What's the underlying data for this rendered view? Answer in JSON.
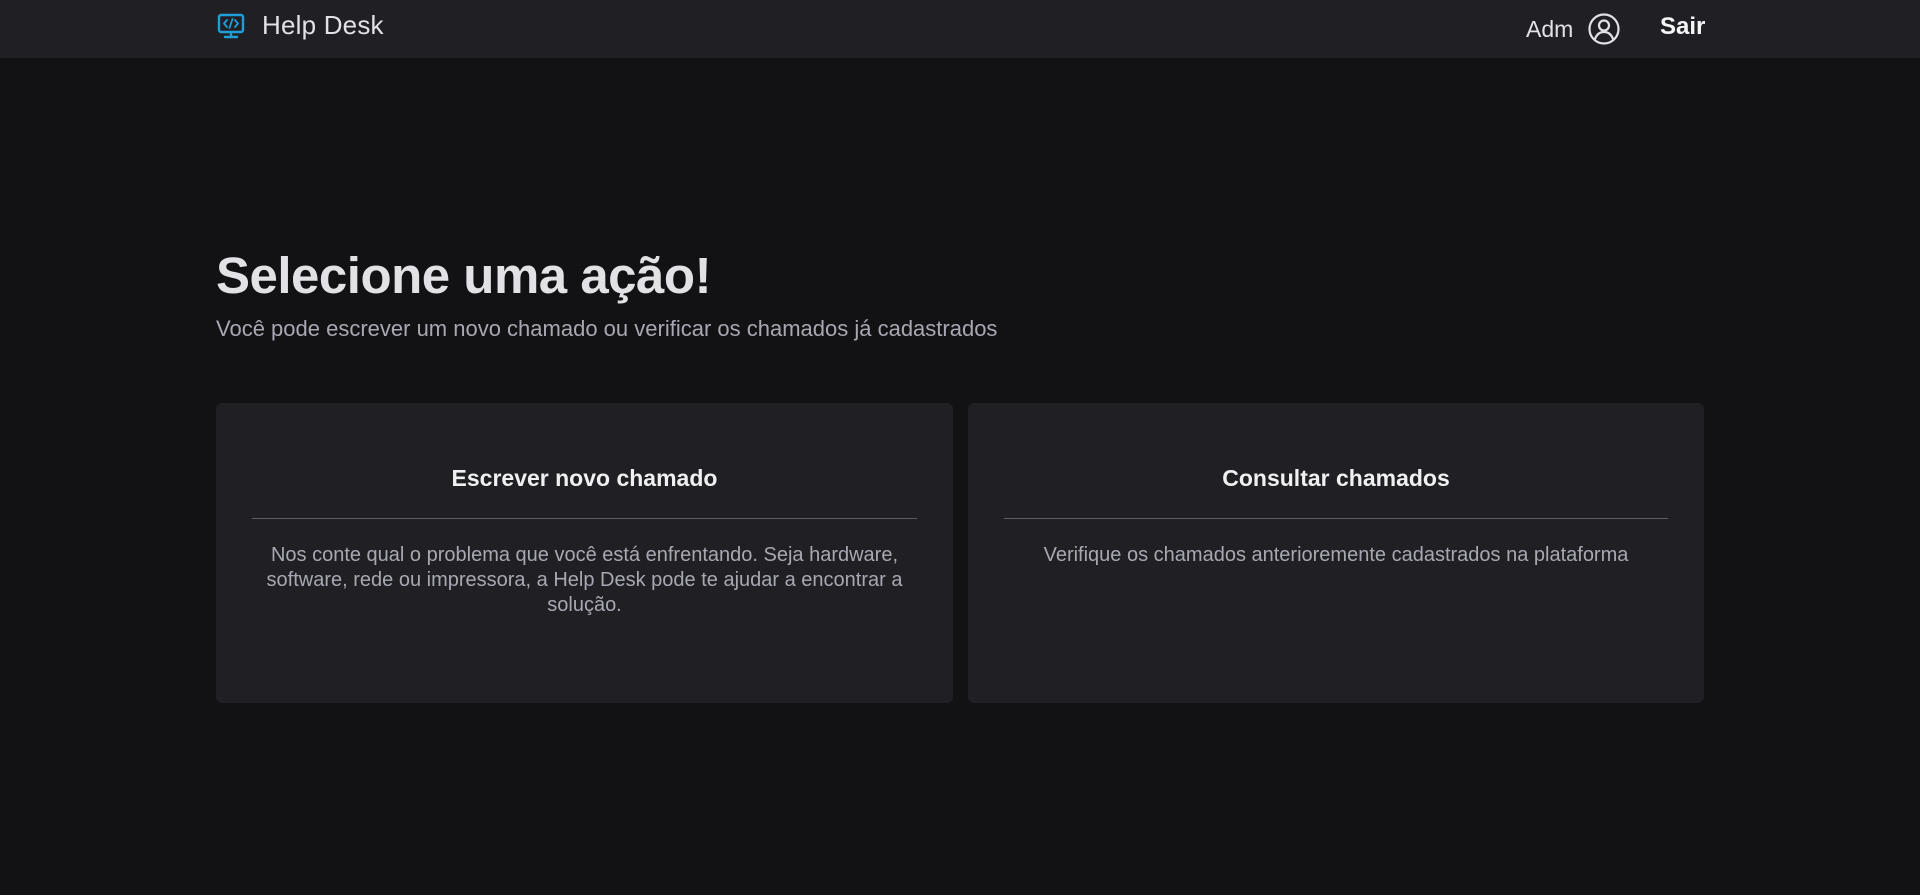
{
  "app": {
    "title": "Help Desk",
    "brand_icon": "monitor-code-icon",
    "accent_color": "#1e9fd8"
  },
  "header": {
    "user_name": "Adm",
    "user_icon": "user-circle-icon",
    "logout_label": "Sair"
  },
  "main": {
    "title": "Selecione uma ação!",
    "subtitle": "Você pode escrever um novo chamado ou verificar os chamados já cadastrados"
  },
  "cards": [
    {
      "title": "Escrever novo chamado",
      "description": "Nos conte qual o problema que você está enfrentando. Seja hardware, software, rede ou impressora, a Help Desk pode te ajudar a encontrar a solução."
    },
    {
      "title": "Consultar chamados",
      "description": "Verifique os chamados anterioremente cadastrados na plataforma"
    }
  ],
  "colors": {
    "background": "#121214",
    "surface": "#202024",
    "text": "#e1e1e6",
    "muted_text": "#a8a8b3"
  }
}
